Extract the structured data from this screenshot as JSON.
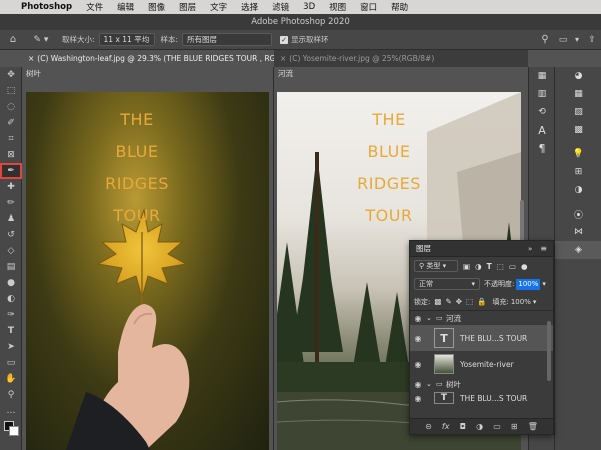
{
  "menubar": {
    "apple": "",
    "items": [
      "Photoshop",
      "文件",
      "编辑",
      "图像",
      "图层",
      "文字",
      "选择",
      "滤镜",
      "3D",
      "视图",
      "窗口",
      "帮助"
    ]
  },
  "window": {
    "title": "Adobe Photoshop 2020"
  },
  "options": {
    "sample_size_label": "取样大小:",
    "sample_size_value": "11 x 11 平均",
    "sample_label": "样本:",
    "sample_value": "所有图层",
    "show_ring_label": "显示取样环"
  },
  "tabs": [
    {
      "label": "(C) Washington-leaf.jpg @ 29.3% (THE BLUE RIDGES TOUR , RGB/8#) *"
    },
    {
      "label": "(C) Yosemite-river.jpg @ 25%(RGB/8#)"
    }
  ],
  "docs": {
    "left": {
      "label": "树叶",
      "poster": [
        "THE",
        "BLUE",
        "RIDGES",
        "TOUR"
      ]
    },
    "right": {
      "label": "河流",
      "poster": [
        "THE",
        "BLUE",
        "RIDGES",
        "TOUR"
      ]
    }
  },
  "layers_panel": {
    "title": "图层",
    "filter_kind": "类型",
    "blend_mode": "正常",
    "opacity_label": "不透明度:",
    "opacity_value": "100%",
    "lock_label": "锁定:",
    "fill_label": "填充:",
    "fill_value": "100%",
    "rows": [
      {
        "type": "group",
        "name": "河流"
      },
      {
        "type": "text",
        "name": "THE BLU...S TOUR"
      },
      {
        "type": "image",
        "name": "Yosemite-river"
      },
      {
        "type": "group",
        "name": "树叶"
      },
      {
        "type": "text",
        "name": "THE BLU...S TOUR"
      }
    ]
  },
  "colors": {
    "accent_red": "#e0463c",
    "poster_text": "#e7a93a",
    "selection_blue": "#1473e6"
  }
}
